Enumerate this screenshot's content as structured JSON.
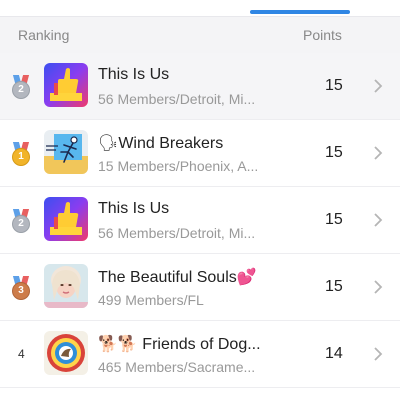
{
  "header": {
    "ranking_label": "Ranking",
    "points_label": "Points"
  },
  "rows": [
    {
      "rank": "2",
      "medal": "silver",
      "title": "This Is Us",
      "subtitle": "56 Members/Detroit, Mi...",
      "points": "15",
      "avatar": "thumbs-up-avatar"
    },
    {
      "rank": "1",
      "medal": "gold",
      "title": "🗣Wind Breakers",
      "subtitle": "15 Members/Phoenix, A...",
      "points": "15",
      "avatar": "runner-avatar"
    },
    {
      "rank": "2",
      "medal": "silver",
      "title": "This Is Us",
      "subtitle": "56 Members/Detroit, Mi...",
      "points": "15",
      "avatar": "thumbs-up-avatar"
    },
    {
      "rank": "3",
      "medal": "bronze",
      "title": "The Beautiful Souls💕",
      "subtitle": "499 Members/FL",
      "points": "15",
      "avatar": "portrait-avatar"
    },
    {
      "rank": "4",
      "medal": "none",
      "title": "🐕🐕 Friends of Dog...",
      "subtitle": "465 Members/Sacrame...",
      "points": "14",
      "avatar": "dog-club-logo-avatar"
    }
  ],
  "colors": {
    "accent": "#2f86e4",
    "gold": "#f1b42a",
    "silver": "#b3b7bf",
    "bronze": "#cd7c4a"
  }
}
